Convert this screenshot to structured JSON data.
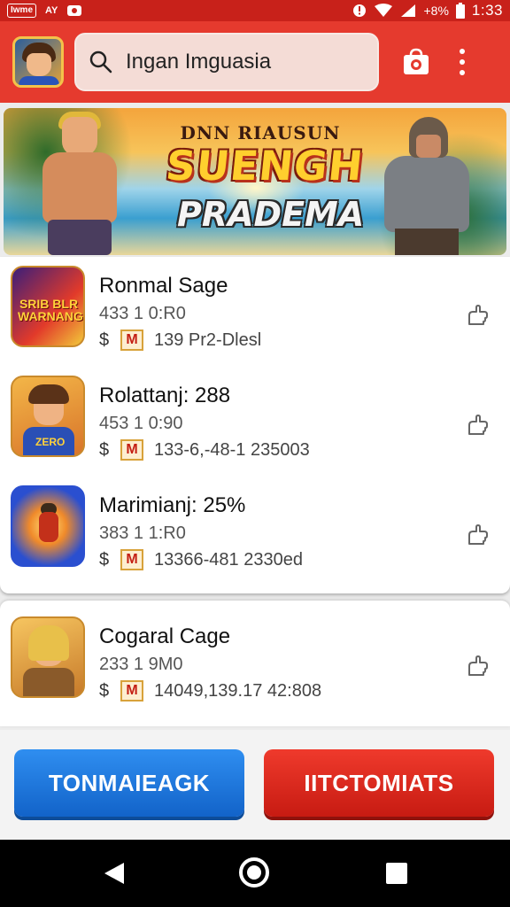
{
  "status_bar": {
    "left_items": [
      "Iwme",
      "AY"
    ],
    "battery_text": "+8%",
    "time": "1:33"
  },
  "app_bar": {
    "search_text": "Ingan Imguasia",
    "icons": [
      "profile-avatar",
      "search-icon",
      "camera-bag-icon",
      "overflow-menu-icon"
    ]
  },
  "banner": {
    "line1": "DNN RIAUSUN",
    "line2": "SUENGH",
    "line3": "PRADEMA"
  },
  "list": [
    {
      "title": "Ronmal Sage",
      "subtitle": "433 1 0:R0",
      "price_symbol": "$",
      "badge": "M",
      "meta": "139 Pr2-Dlesl"
    },
    {
      "title": "Rolattanj: 288",
      "subtitle": "453 1 0:90",
      "price_symbol": "$",
      "badge": "M",
      "meta": "133-6,-48-1 235003"
    },
    {
      "title": "Marimianj: 25%",
      "subtitle": "383 1 1:R0",
      "price_symbol": "$",
      "badge": "M",
      "meta": "13366-481 2330ed"
    },
    {
      "title": "Cogaral Cage",
      "subtitle": "233 1 9M0",
      "price_symbol": "$",
      "badge": "M",
      "meta": "14049,139.17 42:808"
    }
  ],
  "app_icon_labels": {
    "first": "SRIB BLR WARNANG",
    "second_shirt": "ZERO"
  },
  "buttons": {
    "left": "TONMAIEAGK",
    "right": "IITCTOMIATS"
  },
  "colors": {
    "appbar": "#e53a2e",
    "status_bar": "#c8211a",
    "button_blue": "#1f7be0",
    "button_red": "#e0281e"
  }
}
